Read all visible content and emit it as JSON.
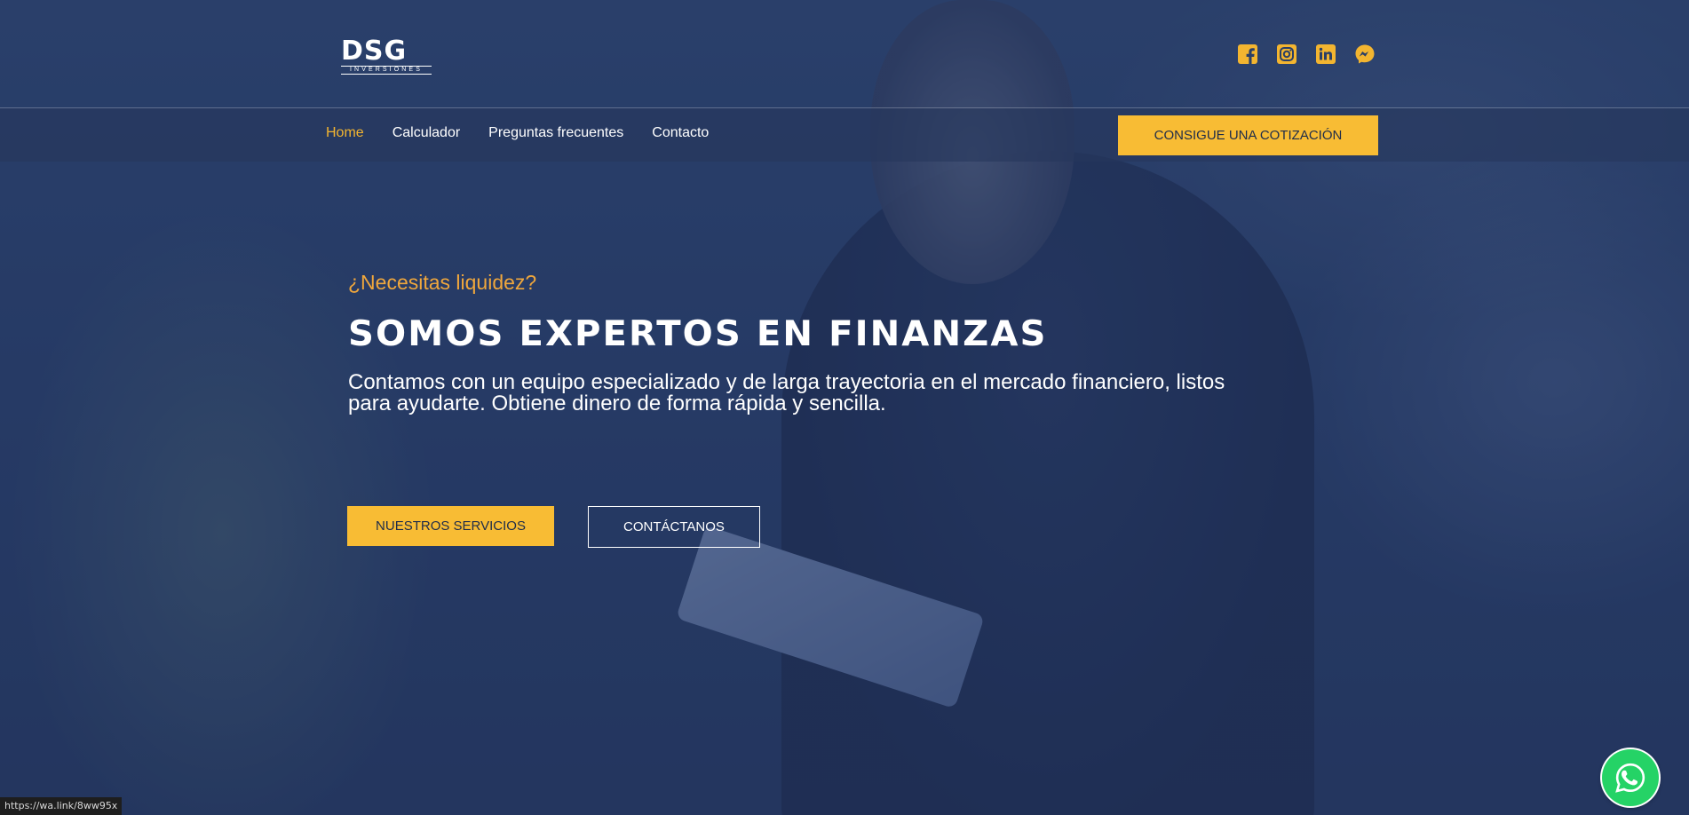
{
  "brand": {
    "logo_main": "DSG",
    "logo_sub": "INVERSIONES"
  },
  "socials": [
    {
      "icon": "facebook-icon"
    },
    {
      "icon": "instagram-icon"
    },
    {
      "icon": "linkedin-icon"
    },
    {
      "icon": "messenger-icon"
    }
  ],
  "nav": {
    "items": [
      {
        "label": "Home",
        "active": true
      },
      {
        "label": "Calculador"
      },
      {
        "label": "Preguntas frecuentes"
      },
      {
        "label": "Contacto"
      }
    ],
    "cta_label": "CONSIGUE UNA COTIZACIÓN"
  },
  "hero": {
    "eyebrow": "¿Necesitas liquidez?",
    "headline": "SOMOS EXPERTOS EN FINANZAS",
    "description": "Contamos con un equipo especializado y de larga trayectoria en el mercado financiero, listos para ayudarte. Obtiene dinero de forma rápida y sencilla.",
    "primary_button": "NUESTROS SERVICIOS",
    "secondary_button": "CONTÁCTANOS"
  },
  "status_bar": {
    "url": "https://wa.link/8ww95x"
  },
  "colors": {
    "accent": "#f8bc34",
    "eyebrow": "#f0a73c",
    "overlay": "#2b3f66",
    "whatsapp": "#25d366"
  }
}
